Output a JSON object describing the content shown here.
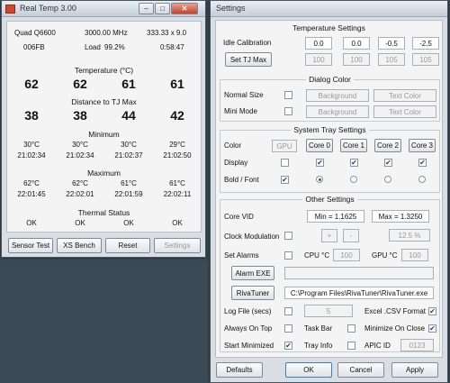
{
  "real_temp": {
    "title": "Real Temp 3.00",
    "cpu_model": "Quad Q6600",
    "frequency": "3000.00 MHz",
    "multiplier": "333.33 x 9.0",
    "vid": "006FB",
    "load_label": "Load",
    "load_value": "99.2%",
    "uptime": "0:58:47",
    "temperature_title": "Temperature (°C)",
    "temperatures": [
      "62",
      "62",
      "61",
      "61"
    ],
    "distance_title": "Distance to TJ Max",
    "distances": [
      "38",
      "38",
      "44",
      "42"
    ],
    "minimum_title": "Minimum",
    "minimum_temps": [
      "30°C",
      "30°C",
      "30°C",
      "29°C"
    ],
    "minimum_times": [
      "21:02:34",
      "21:02:34",
      "21:02:37",
      "21:02:50"
    ],
    "maximum_title": "Maximum",
    "maximum_temps": [
      "62°C",
      "62°C",
      "61°C",
      "61°C"
    ],
    "maximum_times": [
      "22:01:45",
      "22:02:01",
      "22:01:59",
      "22:02:11"
    ],
    "thermal_title": "Thermal Status",
    "thermal_status": [
      "OK",
      "OK",
      "OK",
      "OK"
    ],
    "buttons": {
      "sensor_test": "Sensor Test",
      "xs_bench": "XS Bench",
      "reset": "Reset",
      "settings": "Settings"
    }
  },
  "settings": {
    "title": "Settings",
    "temperature_settings": {
      "title": "Temperature Settings",
      "idle_calibration_label": "Idle Calibration",
      "idle_values": [
        "0.0",
        "0.0",
        "-0.5",
        "-2.5"
      ],
      "set_tj_max_label": "Set TJ Max",
      "tj_max_values": [
        "100",
        "100",
        "105",
        "105"
      ]
    },
    "dialog_color": {
      "title": "Dialog Color",
      "normal_size_label": "Normal Size",
      "mini_mode_label": "Mini Mode",
      "background_label": "Background",
      "text_color_label": "Text Color"
    },
    "system_tray": {
      "title": "System Tray Settings",
      "color_label": "Color",
      "display_label": "Display",
      "bold_font_label": "Bold / Font",
      "gpu_label": "GPU",
      "core_labels": [
        "Core 0",
        "Core 1",
        "Core 2",
        "Core 3"
      ],
      "checkmark": "✔"
    },
    "other_settings": {
      "title": "Other Settings",
      "core_vid_label": "Core VID",
      "vid_min": "Min = 1.1625",
      "vid_max": "Max = 1.3250",
      "clock_modulation_label": "Clock Modulation",
      "plus_label": "+",
      "minus_label": "-",
      "clock_modulation_value": "12.5 %",
      "set_alarms_label": "Set Alarms",
      "cpu_alarm_label": "CPU °C",
      "cpu_alarm_value": "100",
      "gpu_alarm_label": "GPU °C",
      "gpu_alarm_value": "100",
      "alarm_exe_label": "Alarm EXE",
      "alarm_exe_path": "",
      "rivatuner_label": "RivaTuner",
      "rivatuner_path": "C:\\Program Files\\RivaTuner\\RivaTuner.exe",
      "log_file_label": "Log File (secs)",
      "log_file_value": "5",
      "excel_csv_label": "Excel .CSV Format",
      "always_on_top_label": "Always On Top",
      "task_bar_label": "Task Bar",
      "minimize_on_close_label": "Minimize On Close",
      "start_minimized_label": "Start Minimized",
      "tray_info_label": "Tray Info",
      "apic_id_label": "APIC ID",
      "apic_id_value": "0123"
    },
    "buttons": {
      "defaults": "Defaults",
      "ok": "OK",
      "cancel": "Cancel",
      "apply": "Apply"
    }
  }
}
